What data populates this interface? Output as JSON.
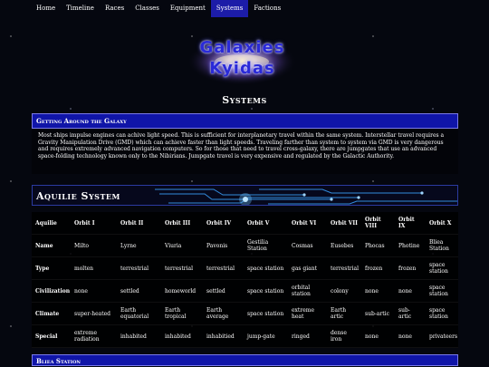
{
  "nav": [
    "Home",
    "Timeline",
    "Races",
    "Classes",
    "Equipment",
    "Systems",
    "Factions"
  ],
  "nav_active": "Systems",
  "logo": {
    "line1": "Galaxies",
    "line2": "Kyidas"
  },
  "page_title": "Systems",
  "intro": {
    "heading": "Getting Around the Galaxy",
    "body": "Most ships impulse engines can achive light speed. This is sufficient for interplanetary travel within the same system. Interstellar travel requires a Gravity Manipulation Drive (GMD) which can achieve faster than light speeds. Traveling farther than system to system via GMD is very dangerous and requires extremely advanced navigation computers. So for those that need to travel cross-galaxy, there are jumpgates that use an advanced space-folding technology known only to the Nibirians. Jumpgate travel is very expensive and regulated by the Galactic Authority."
  },
  "aquilie": {
    "title": "Aquilie System",
    "columns": [
      "Aquilie",
      "Orbit I",
      "Orbit II",
      "Orbit III",
      "Orbit IV",
      "Orbit V",
      "Orbit VI",
      "Orbit VII",
      "Orbit VIII",
      "Orbit IX",
      "Orbit X"
    ],
    "rows": [
      [
        "Name",
        "Milto",
        "Lyrne",
        "Viuria",
        "Pavonis",
        "Gestilia Station",
        "Cosmas",
        "Eusebes",
        "Phocas",
        "Photine",
        "Bliea Station"
      ],
      [
        "Type",
        "molten",
        "terrestrial",
        "terrestrial",
        "terrestrial",
        "space station",
        "gas giant",
        "terrestrial",
        "frozen",
        "frozen",
        "space station"
      ],
      [
        "Civilization",
        "none",
        "settled",
        "homeworld",
        "settled",
        "space station",
        "orbital station",
        "colony",
        "none",
        "none",
        "space station"
      ],
      [
        "Climate",
        "super-heated",
        "Earth equatorial",
        "Earth tropical",
        "Earth average",
        "space station",
        "extreme heat",
        "Earth artic",
        "sub-artic",
        "sub-artic",
        "space station"
      ],
      [
        "Special",
        "extreme radiation",
        "inhabited",
        "inhabited",
        "inhabitied",
        "jump-gate",
        "ringed",
        "dense iron",
        "none",
        "none",
        "privateers"
      ]
    ]
  },
  "next_section": {
    "title": "Bliea Station"
  }
}
